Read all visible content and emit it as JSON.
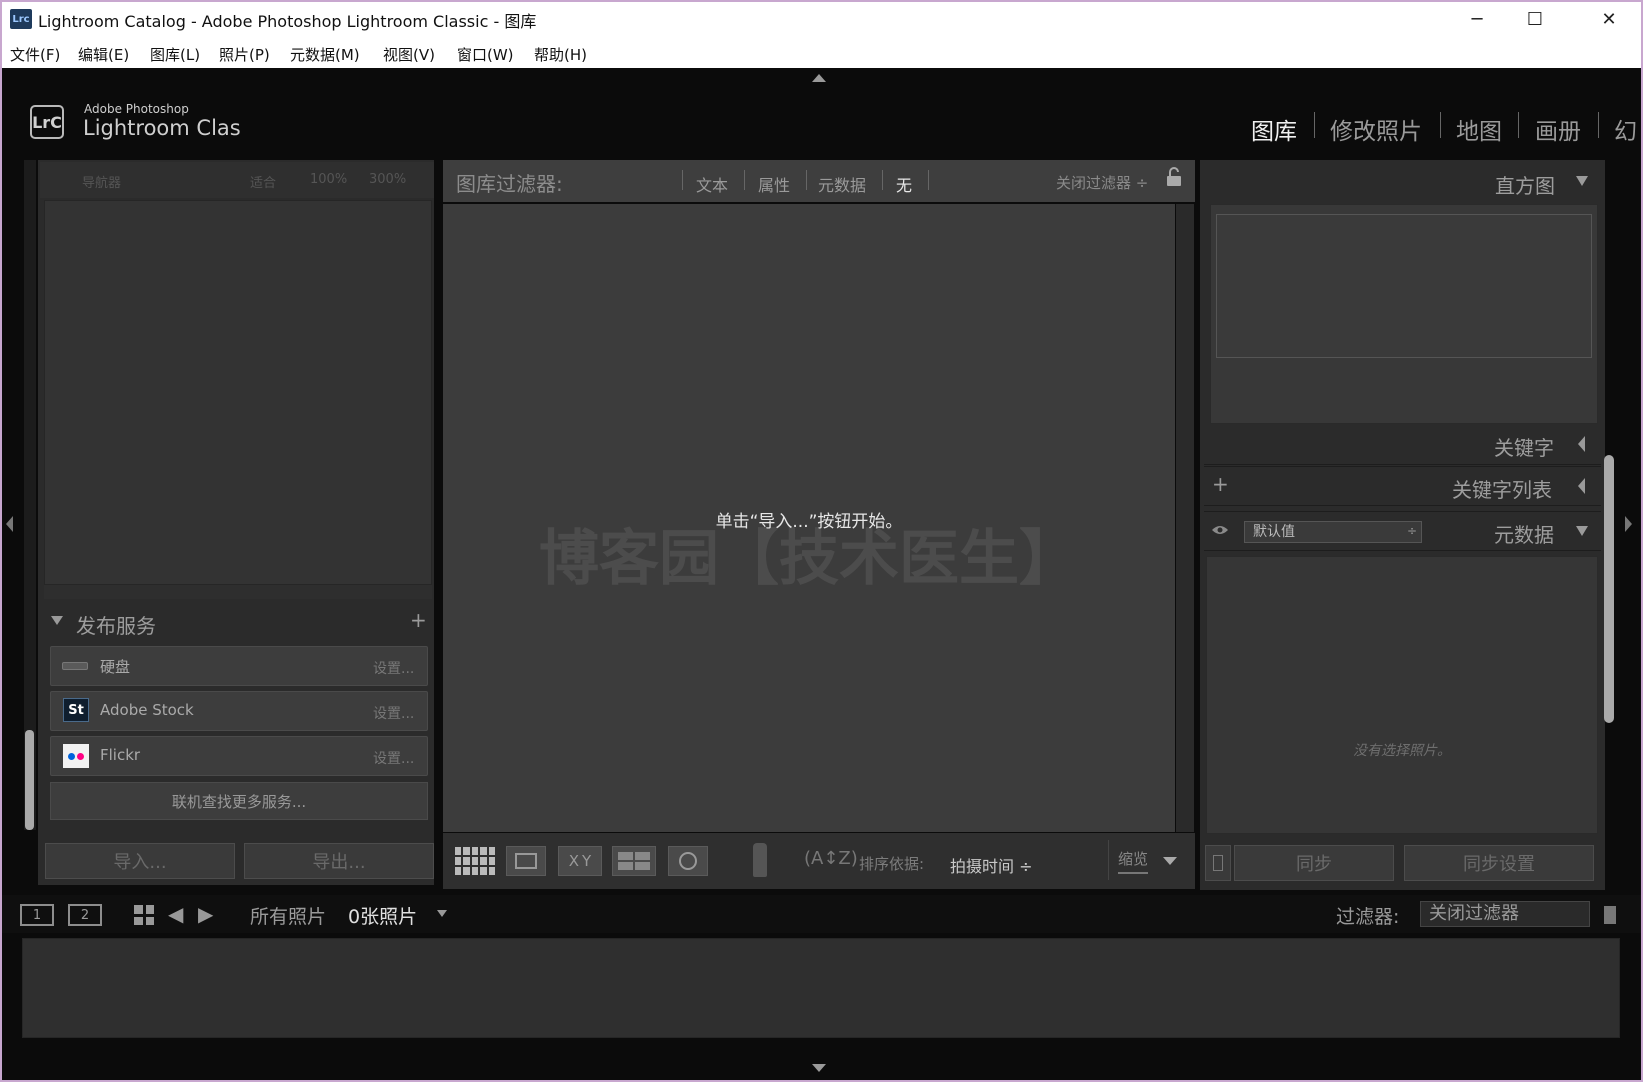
{
  "window": {
    "title": "Lightroom Catalog - Adobe Photoshop Lightroom Classic - 图库",
    "icon_text": "Lrc",
    "controls": {
      "minimize": "─",
      "maximize": "☐",
      "close": "✕"
    }
  },
  "menu": [
    "文件(F)",
    "编辑(E)",
    "图库(L)",
    "照片(P)",
    "元数据(M)",
    "视图(V)",
    "窗口(W)",
    "帮助(H)"
  ],
  "brand": {
    "logo": "LrC",
    "small": "Adobe Photoshop",
    "big": "Lightroom Classic"
  },
  "modules": [
    "图库",
    "修改照片",
    "地图",
    "画册",
    "幻"
  ],
  "navigator": {
    "title": "导航器",
    "zoom": [
      "适合",
      "100%",
      "300%"
    ]
  },
  "publish": {
    "title": "发布服务",
    "add": "+",
    "services": [
      {
        "name": "硬盘",
        "setting": "设置..."
      },
      {
        "name": "Adobe Stock",
        "setting": "设置..."
      },
      {
        "name": "Flickr",
        "setting": "设置..."
      }
    ],
    "find_more": "联机查找更多服务..."
  },
  "left_buttons": {
    "import": "导入...",
    "export": "导出..."
  },
  "filter_bar": {
    "title": "图库过滤器:",
    "options": [
      "文本",
      "属性",
      "元数据",
      "无"
    ],
    "close": "关闭过滤器 ÷"
  },
  "grid": {
    "empty_message": "单击“导入...”按钮开始。",
    "watermark": "博客园【技术医生】"
  },
  "toolbar": {
    "sort_label": "排序依据:",
    "sort_value": "拍摄时间 ÷",
    "zoom_label": "缩览"
  },
  "right_panel": {
    "histogram": "直方图",
    "keywording": "关键字",
    "keyword_list": "关键字列表",
    "metadata": "元数据",
    "metadata_preset": "默认值",
    "no_photo": "没有选择照片。",
    "sync": "同步",
    "sync_settings": "同步设置"
  },
  "filmstrip": {
    "view1": "1",
    "view2": "2",
    "source": "所有照片",
    "count": "0张照片",
    "filter_label": "过滤器:",
    "filter_value": "关闭过滤器"
  },
  "colors": {
    "panel": "#2b2b2b",
    "background": "#0b0b0b",
    "grid": "#3c3c3c",
    "active_module": "#f0f0f0"
  }
}
